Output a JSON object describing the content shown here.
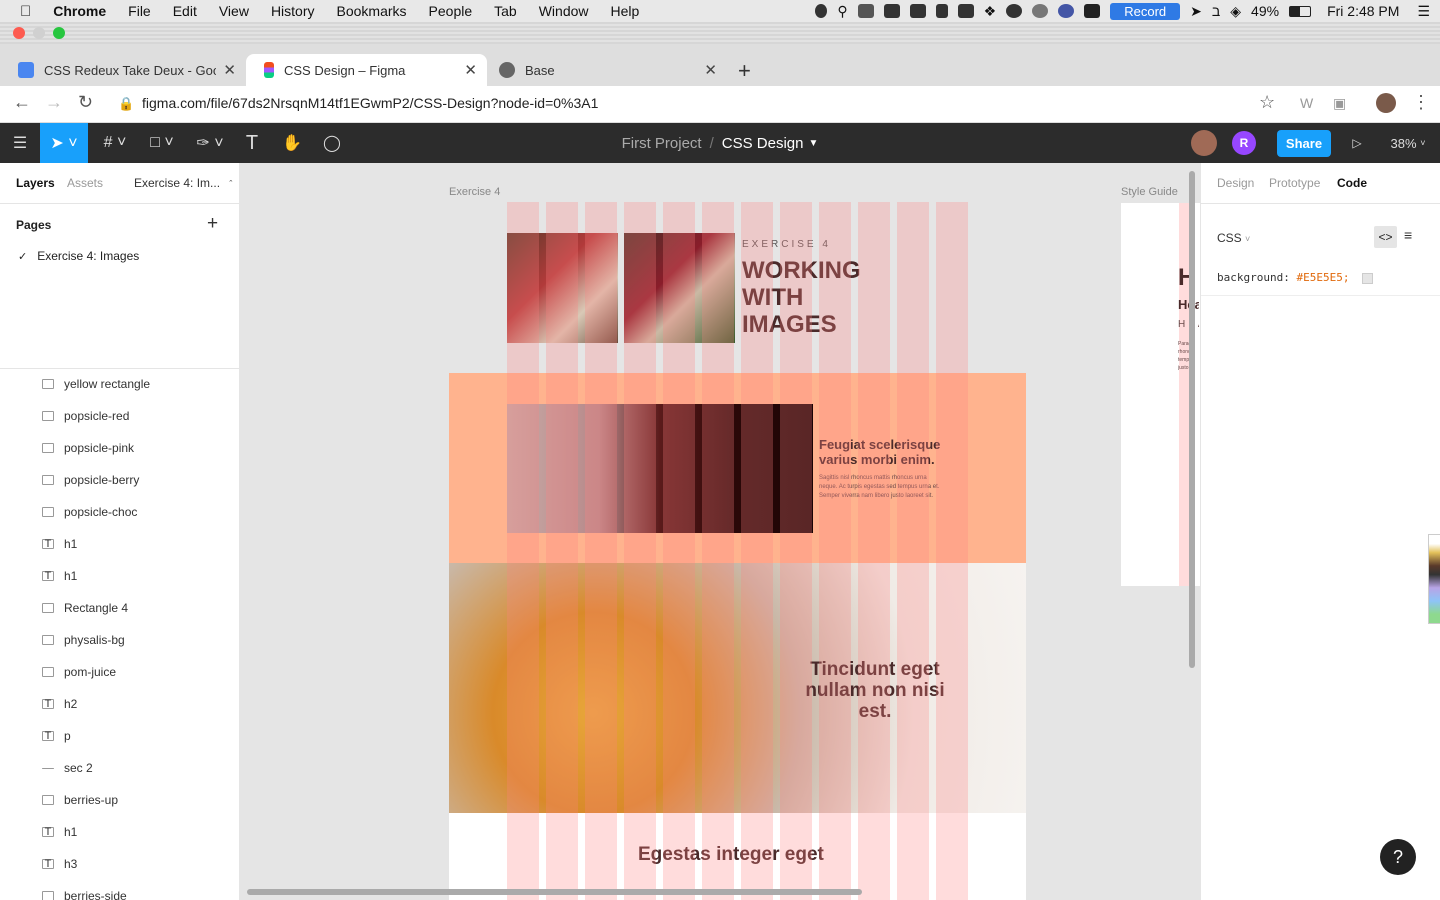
{
  "menubar": {
    "app": "Chrome",
    "items": [
      "File",
      "Edit",
      "View",
      "History",
      "Bookmarks",
      "People",
      "Tab",
      "Window",
      "Help"
    ],
    "record": "Record",
    "battery": "49%",
    "clock": "Fri 2:48 PM"
  },
  "tabs": [
    {
      "label": "CSS Redeux Take Deux - Goog",
      "active": false
    },
    {
      "label": "CSS Design – Figma",
      "active": true
    },
    {
      "label": "Base",
      "active": false
    }
  ],
  "address": {
    "url": "figma.com/file/67ds2NrsqnM14tf1EGwmP2/CSS-Design?node-id=0%3A1"
  },
  "figma": {
    "project": "First Project",
    "separator": "/",
    "file": "CSS Design",
    "avatar_letter": "R",
    "share": "Share",
    "zoom": "38%"
  },
  "left_panel": {
    "tab_layers": "Layers",
    "tab_assets": "Assets",
    "page_selector": "Exercise 4: Im...",
    "pages_heading": "Pages",
    "pages": [
      "Exercise 4: Images"
    ],
    "layers": [
      {
        "name": "yellow rectangle",
        "icon": "rect"
      },
      {
        "name": "popsicle-red",
        "icon": "img"
      },
      {
        "name": "popsicle-pink",
        "icon": "img"
      },
      {
        "name": "popsicle-berry",
        "icon": "img"
      },
      {
        "name": "popsicle-choc",
        "icon": "img"
      },
      {
        "name": "h1",
        "icon": "text"
      },
      {
        "name": "h1",
        "icon": "text"
      },
      {
        "name": "Rectangle 4",
        "icon": "rect"
      },
      {
        "name": "physalis-bg",
        "icon": "img"
      },
      {
        "name": "pom-juice",
        "icon": "img"
      },
      {
        "name": "h2",
        "icon": "text"
      },
      {
        "name": "p",
        "icon": "text"
      },
      {
        "name": "sec 2",
        "icon": "line"
      },
      {
        "name": "berries-up",
        "icon": "img"
      },
      {
        "name": "h1",
        "icon": "text"
      },
      {
        "name": "h3",
        "icon": "text"
      },
      {
        "name": "berries-side",
        "icon": "img"
      }
    ]
  },
  "canvas": {
    "frame_label": "Exercise 4",
    "style_guide_label": "Style Guide",
    "eyebrow": "EXERCISE 4",
    "headline": [
      "WORKING",
      "WITH",
      "IMAGES"
    ],
    "section2_heading": [
      "Feugiat scelerisque",
      "varius morbi enim."
    ],
    "section2_body": [
      "Sagittis nisl rhoncus mattis rhoncus urna",
      "neque. Ac turpis egestas sed tempus urna et.",
      "Semper viverra nam libero justo laoreet sit."
    ],
    "section3_heading": [
      "Tincidunt eget",
      "nullam non nisi",
      "est."
    ],
    "section4_heading": "Egestas integer eget",
    "style_guide_glyphs": [
      "H",
      "Hea",
      "HEA"
    ],
    "style_guide_para": [
      "Parag",
      "rhoncu",
      "tempu",
      "justo l"
    ]
  },
  "right_panel": {
    "tab_design": "Design",
    "tab_prototype": "Prototype",
    "tab_code": "Code",
    "lang": "CSS",
    "code_prop": "background:",
    "code_value": "#E5E5E5;"
  },
  "colors": {
    "figma_blue": "#18a0fb",
    "canvas_bg": "#e5e5e5",
    "salmon": "#ffb38e",
    "column_overlay": "#ff8282"
  }
}
